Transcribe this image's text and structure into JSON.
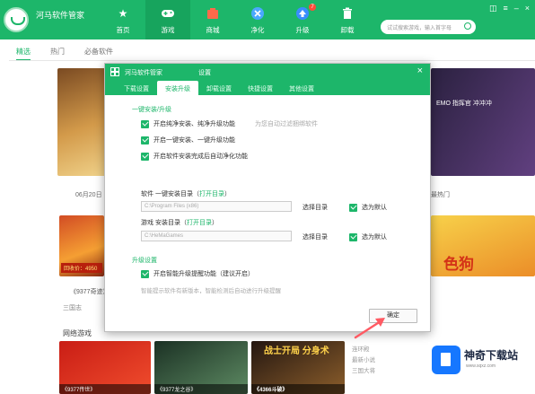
{
  "app": {
    "title": "河马软件管家"
  },
  "nav": [
    {
      "label": "首页",
      "icon": "star"
    },
    {
      "label": "游戏",
      "icon": "gamepad"
    },
    {
      "label": "商城",
      "icon": "shop"
    },
    {
      "label": "净化",
      "icon": "clean"
    },
    {
      "label": "升级",
      "icon": "upgrade",
      "badge": "7"
    },
    {
      "label": "卸载",
      "icon": "trash"
    }
  ],
  "search": {
    "placeholder": "试试搜索游戏，输入首字母"
  },
  "subtabs": [
    "精选",
    "热门",
    "必备软件"
  ],
  "background": {
    "banner_right_text": "EMO 指挥官\n冲冲冲",
    "date_chip": "06月20日",
    "hot_chip": "最热门",
    "game1_price": "回收价：4950",
    "under1": "《9377奇迹》",
    "under2": "三国志",
    "game2_text": "色狗",
    "net_games_title": "网络游戏",
    "b1_caption": "《9377传世》",
    "b2_caption": "《9377龙之谷》",
    "b3_title": "战士开局 分身术",
    "b3_caption": "《4366斗破》",
    "right_list": [
      "连环殿",
      "最新小说",
      "三国大将"
    ]
  },
  "dialog": {
    "title": "河马软件管家",
    "subtitle": "设置",
    "close": "×",
    "tabs": [
      "下载设置",
      "安装升级",
      "卸载设置",
      "快捷设置",
      "其他设置"
    ],
    "active_tab": 1,
    "section1": "一键安装/升级",
    "options": [
      {
        "label": "开启纯净安装、纯净升级功能",
        "hint": "为您自动过滤捆绑软件"
      },
      {
        "label": "开启一键安装、一键升级功能",
        "hint": ""
      },
      {
        "label": "开启软件安装完成后自动净化功能",
        "hint": ""
      }
    ],
    "software_dir": {
      "label": "软件 一键安装目录（",
      "link": "打开目录",
      "close": "）",
      "path": "C:\\Program Files (x86)",
      "choose": "选择目录",
      "default": "选为默认"
    },
    "game_dir": {
      "label": "游戏 安装目录（",
      "link": "打开目录",
      "close": "）",
      "path": "C:\\HeMaGames",
      "choose": "选择目录",
      "default": "选为默认"
    },
    "section2": "升级设置",
    "upgrade_option": "开启智能升级提醒功能（建议开启）",
    "upgrade_desc": "智能提示软件有新版本，智能检测后自动进行升级提醒",
    "ok": "确定"
  },
  "watermark": {
    "name": "神奇下载站",
    "url": "www.sqxz.com"
  },
  "colors": {
    "accent": "#1db66a",
    "badge": "#ff4b3a"
  }
}
